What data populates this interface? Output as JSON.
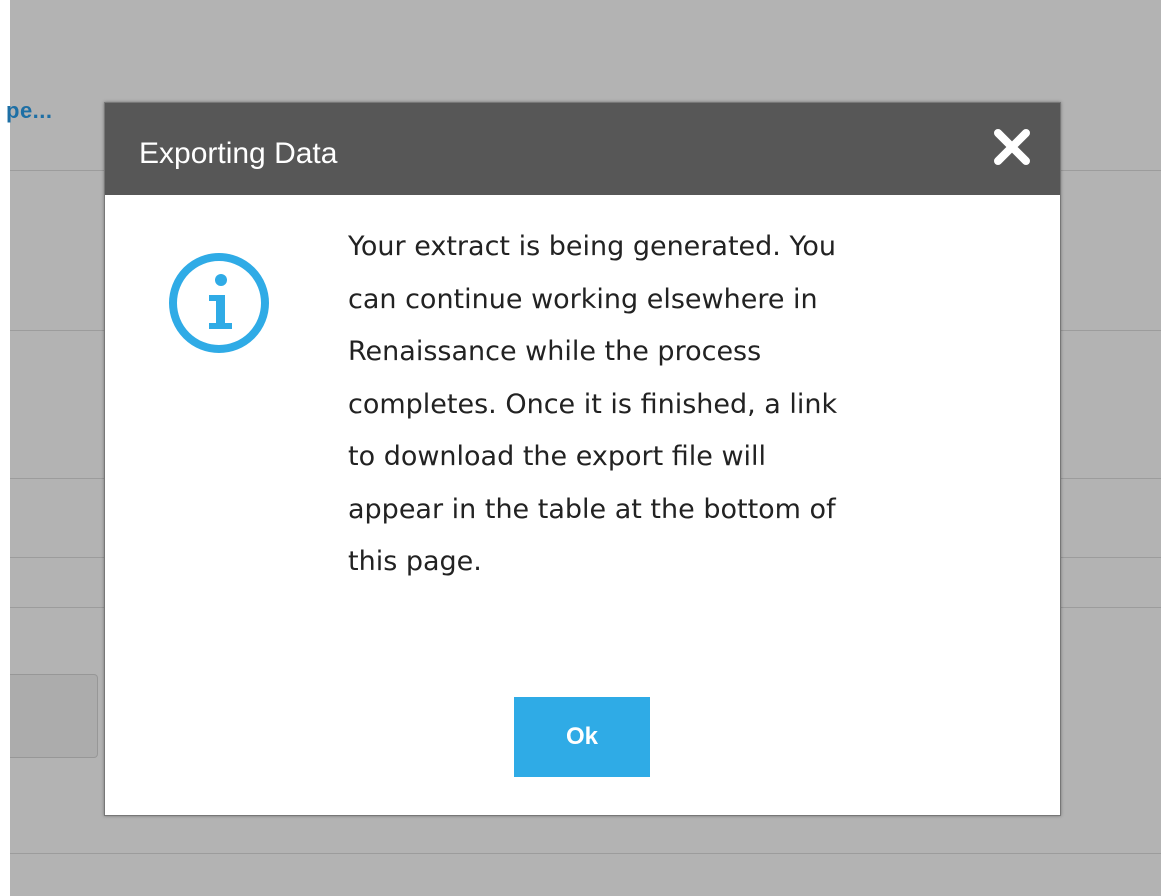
{
  "background": {
    "link_text": "pe...",
    "colors": {
      "overlay": "#b3b3b3",
      "link": "#1d6fa5"
    }
  },
  "modal": {
    "title": "Exporting Data",
    "close_icon": "close-icon",
    "info_icon": "info-circle-icon",
    "message_lines": [
      "Your extract is being generated. You",
      "can continue working elsewhere in",
      "Renaissance while the process",
      "completes. Once it is finished, a link",
      "to download the export file will",
      "appear in the table at the bottom of",
      "this page."
    ],
    "ok_label": "Ok",
    "colors": {
      "header": "#575757",
      "accent": "#2fabe6",
      "icon": "#2fabe6"
    }
  }
}
